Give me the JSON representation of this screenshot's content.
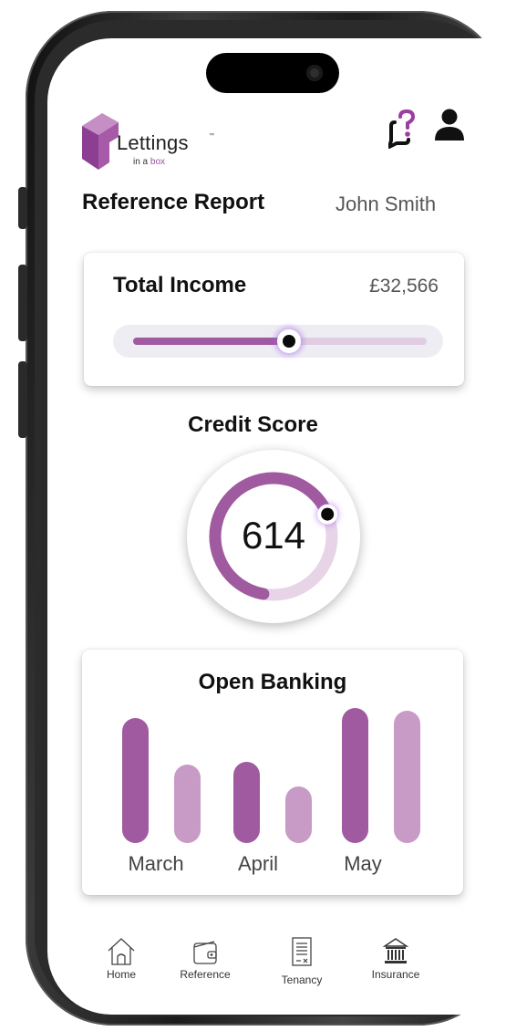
{
  "app": {
    "brand": {
      "name": "Lettings",
      "trademark": "™",
      "tagline_prefix": "in a ",
      "tagline_highlight": "box"
    },
    "colors": {
      "accent": "#a05aa0",
      "accent_light": "#c89ac6",
      "text": "#111111"
    }
  },
  "header": {
    "help_icon": "chat-question-icon",
    "user_icon": "user-icon",
    "title": "Reference Report",
    "tenant_name": "John Smith"
  },
  "income": {
    "label": "Total Income",
    "value": "£32,566",
    "slider_fraction": 0.53
  },
  "credit": {
    "label": "Credit Score",
    "score": "614",
    "gauge_fraction": 0.66
  },
  "banking": {
    "title": "Open Banking",
    "months": [
      "March",
      "April",
      "May"
    ]
  },
  "chart_data": {
    "type": "bar",
    "title": "Open Banking",
    "categories": [
      "March",
      "April",
      "May"
    ],
    "series": [
      {
        "values": [
          100,
          65,
          108
        ],
        "color": "#a05aa0"
      },
      {
        "values": [
          63,
          45,
          106
        ],
        "color": "#c89ac6"
      }
    ],
    "note_values_are_relative": true
  },
  "nav": {
    "items": [
      {
        "label": "Home",
        "icon": "home-icon"
      },
      {
        "label": "Reference",
        "icon": "wallet-icon"
      },
      {
        "label": "Tenancy",
        "icon": "contract-icon"
      },
      {
        "label": "Insurance",
        "icon": "bank-icon"
      }
    ]
  }
}
